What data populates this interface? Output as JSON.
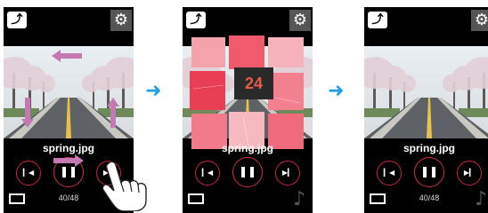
{
  "screens": [
    {
      "filename": "spring.jpg",
      "counter": "40/48"
    },
    {
      "filename": "spring.jpg",
      "overlay_number": "24"
    },
    {
      "filename": "spring.jpg",
      "counter": "40/48"
    }
  ],
  "icons": {
    "back": "back-arrow-icon",
    "settings": "gear-icon",
    "prev": "skip-previous-icon",
    "pause": "pause-icon",
    "next": "skip-next-icon",
    "screen": "screen-icon",
    "music": "music-note-icon",
    "hand": "hand-tap-icon",
    "flow": "right-arrow-icon"
  },
  "colors": {
    "control_ring": "#c4283a",
    "flow_arrow": "#1e9fe3",
    "swipe_arrow": "#c479b2",
    "tile_pink": "#f06a7a"
  }
}
